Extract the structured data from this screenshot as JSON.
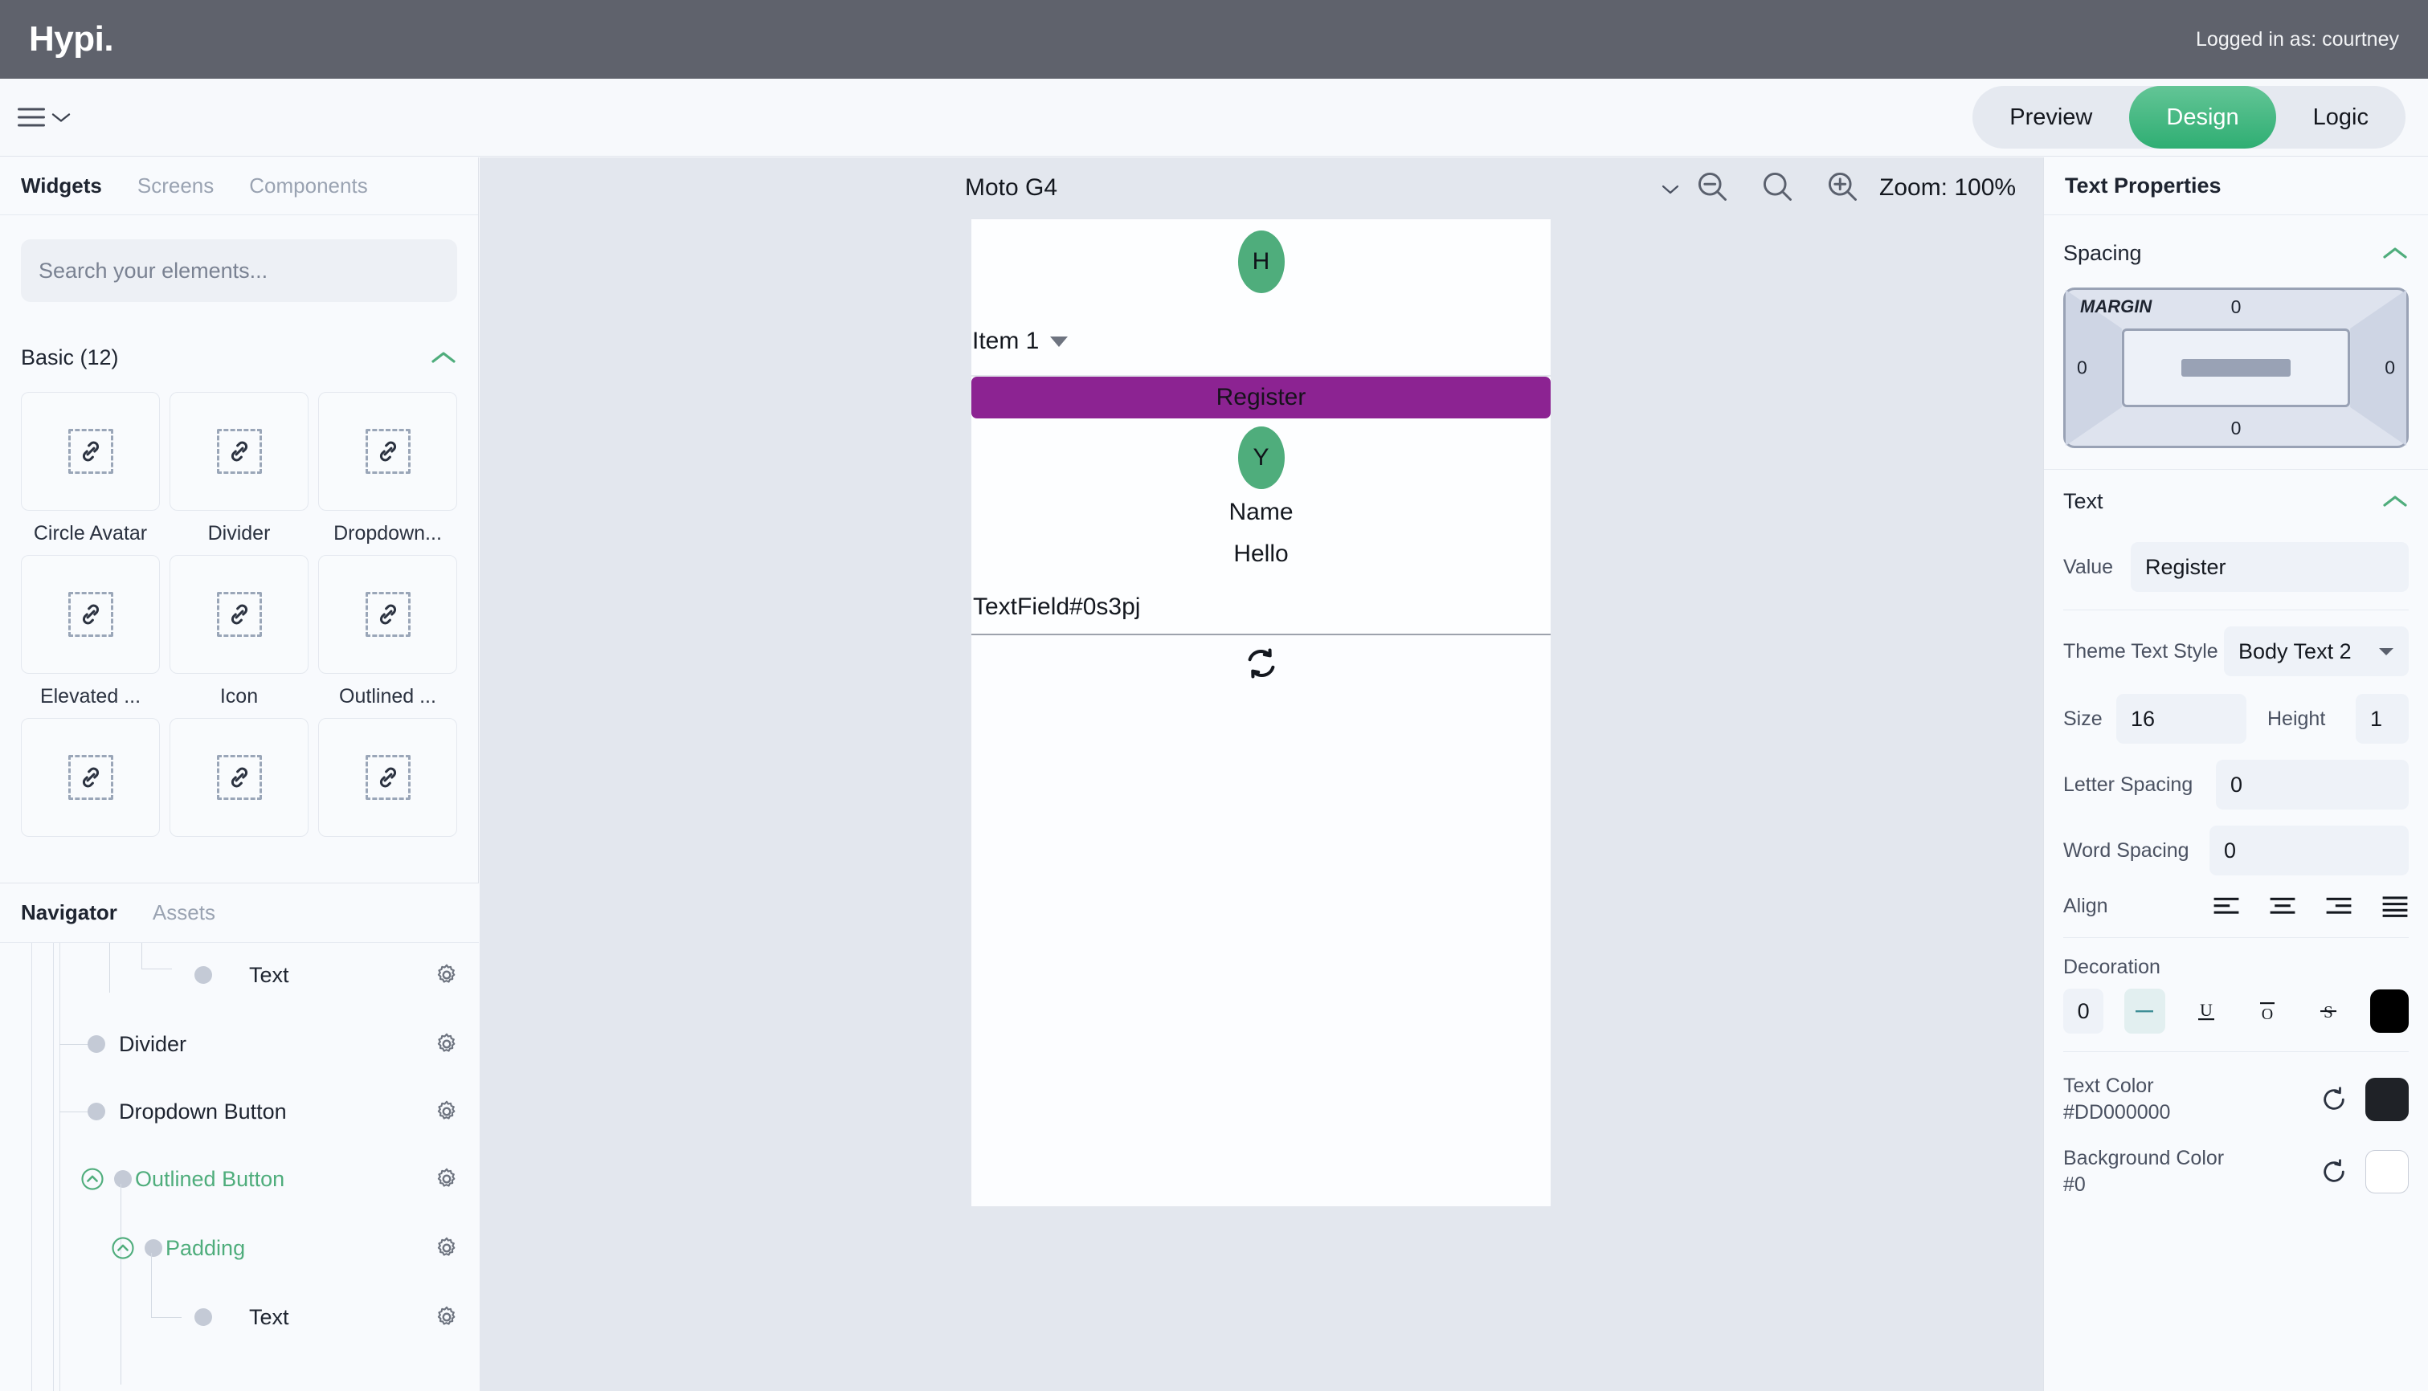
{
  "topbar": {
    "brand": "Hypi.",
    "logged_in_as": "Logged in as: courtney"
  },
  "modebar": {
    "menu_icon": "hamburger-menu-icon",
    "modes": [
      {
        "label": "Preview",
        "active": false
      },
      {
        "label": "Design",
        "active": true
      },
      {
        "label": "Logic",
        "active": false
      }
    ],
    "active_color": "#2FAE73"
  },
  "left_panel": {
    "tabs": [
      {
        "label": "Widgets",
        "active": true
      },
      {
        "label": "Screens",
        "active": false
      },
      {
        "label": "Components",
        "active": false
      }
    ],
    "search": {
      "placeholder": "Search your elements...",
      "value": ""
    },
    "category": {
      "label": "Basic (12)",
      "expanded": true
    },
    "widgets": [
      {
        "label": "Circle Avatar"
      },
      {
        "label": "Divider"
      },
      {
        "label": "Dropdown..."
      },
      {
        "label": "Elevated ..."
      },
      {
        "label": "Icon"
      },
      {
        "label": "Outlined ..."
      },
      {
        "label": ""
      },
      {
        "label": ""
      },
      {
        "label": ""
      }
    ]
  },
  "navigator": {
    "tabs": [
      {
        "label": "Navigator",
        "active": true
      },
      {
        "label": "Assets",
        "active": false
      }
    ],
    "nodes": [
      {
        "label": "Text",
        "depth": 4,
        "selected": false,
        "expandable": false
      },
      {
        "label": "Divider",
        "depth": 2,
        "selected": false,
        "expandable": false
      },
      {
        "label": "Dropdown Button",
        "depth": 2,
        "selected": false,
        "expandable": false
      },
      {
        "label": "Outlined Button",
        "depth": 2,
        "selected": true,
        "expandable": true
      },
      {
        "label": "Padding",
        "depth": 3,
        "selected": true,
        "expandable": true
      },
      {
        "label": "Text",
        "depth": 4,
        "selected": false,
        "expandable": false
      }
    ],
    "selected_color": "#4FAD7C"
  },
  "canvas": {
    "device": "Moto G4",
    "zoom_label": "Zoom: 100%",
    "zoom_out_icon": "zoom-out-icon",
    "zoom_reset_icon": "search-icon",
    "zoom_in_icon": "zoom-in-icon",
    "preview": {
      "avatar_top": "H",
      "dropdown_value": "Item 1",
      "register_button": "Register",
      "avatar_mid": "Y",
      "name_text": "Name",
      "hello_text": "Hello",
      "textfield_label": "TextField#0s3pj",
      "sync_icon": "sync-icon",
      "avatar_color": "#4FAD7C",
      "button_color": "#8C2392"
    }
  },
  "properties": {
    "title": "Text Properties",
    "spacing": {
      "title": "Spacing",
      "box_label": "MARGIN",
      "top": "0",
      "right": "0",
      "bottom": "0",
      "left": "0"
    },
    "text": {
      "title": "Text",
      "value_label": "Value",
      "value": "Register",
      "theme_style_label": "Theme Text Style",
      "theme_style": "Body Text 2",
      "size_label": "Size",
      "size": "16",
      "height_label": "Height",
      "height": "1",
      "letter_spacing_label": "Letter Spacing",
      "letter_spacing": "0",
      "word_spacing_label": "Word Spacing",
      "word_spacing": "0",
      "align_label": "Align",
      "align_options": [
        "align-left-icon",
        "align-center-icon",
        "align-right-icon",
        "align-justify-icon"
      ]
    },
    "decoration": {
      "label": "Decoration",
      "thickness": "0",
      "options": [
        "none-icon",
        "underline-icon",
        "overline-icon",
        "line-through-icon"
      ],
      "active_option": "none-icon",
      "swatch": "#000000"
    },
    "text_color": {
      "label": "Text Color",
      "value": "#DD000000",
      "swatch": "#1F2227",
      "reset_icon": "reset-icon"
    },
    "background_color": {
      "label": "Background Color",
      "value": "#0",
      "swatch": "#FFFFFF",
      "reset_icon": "reset-icon"
    }
  }
}
